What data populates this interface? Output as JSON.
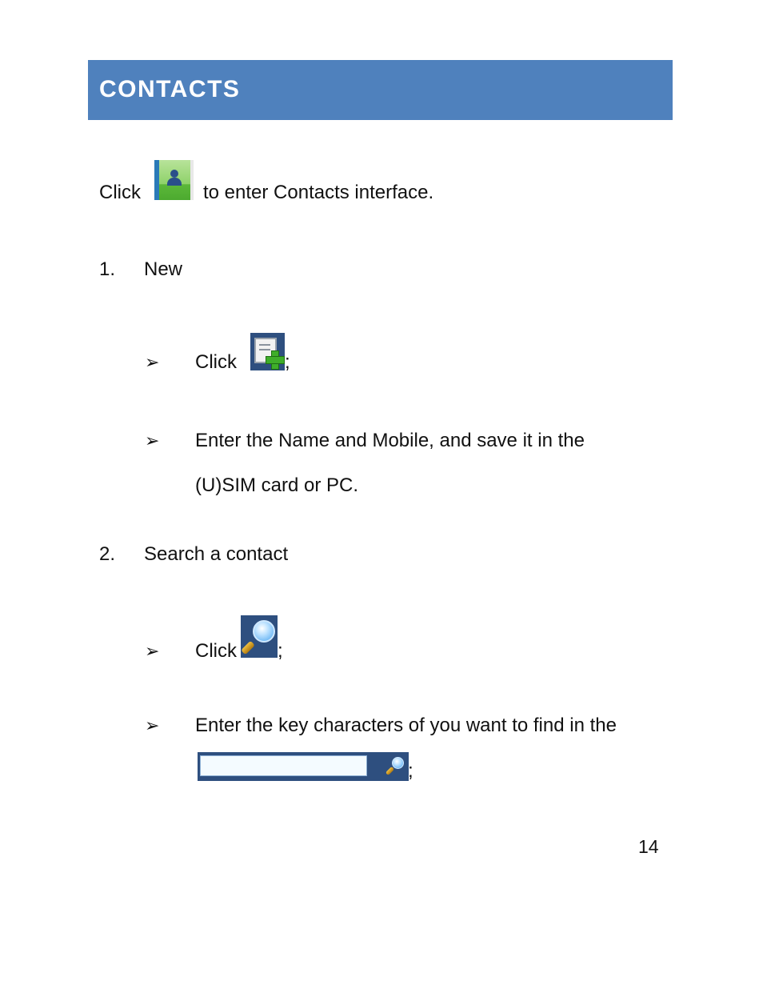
{
  "section": {
    "title": "CONTACTS",
    "banner_color": "#4f81bd"
  },
  "intro": {
    "prefix": "Click",
    "icon": "contacts-book-icon",
    "suffix": "to enter Contacts interface."
  },
  "steps": [
    {
      "number": "1.",
      "title": "New",
      "bullets": [
        {
          "marker": "➢",
          "prefix": "Click",
          "icon": "new-contact-icon",
          "suffix": ";"
        },
        {
          "marker": "➢",
          "line1": "Enter the Name and Mobile, and save it in the",
          "line2": "(U)SIM card or PC."
        }
      ]
    },
    {
      "number": "2.",
      "title": "Search a contact",
      "bullets": [
        {
          "marker": "➢",
          "prefix": "Click",
          "icon": "search-icon",
          "suffix": ";"
        },
        {
          "marker": "➢",
          "line1": "Enter the key characters of you want to find in the",
          "field_value": "",
          "suffix": ";"
        }
      ]
    }
  ],
  "page_number": "14"
}
